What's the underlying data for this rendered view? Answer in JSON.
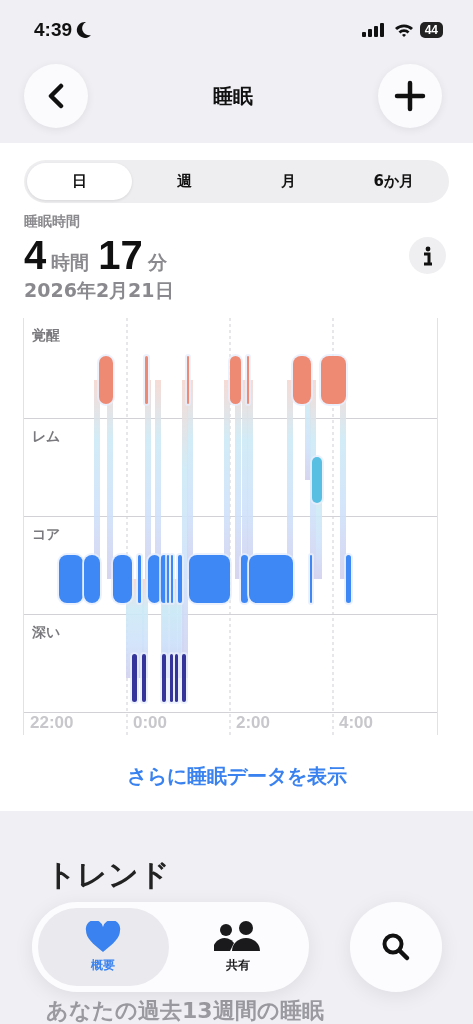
{
  "status_bar": {
    "time": "4:39",
    "battery": "44"
  },
  "nav": {
    "title": "睡眠"
  },
  "period_tabs": [
    {
      "label": "日",
      "selected": true
    },
    {
      "label": "週",
      "selected": false
    },
    {
      "label": "月",
      "selected": false
    },
    {
      "label": "6か月",
      "selected": false
    }
  ],
  "summary": {
    "label": "睡眠時間",
    "hours": "4",
    "hours_unit": "時間",
    "minutes": "17",
    "minutes_unit": "分",
    "date": "2026年2月21日"
  },
  "stages": [
    "覚醒",
    "レム",
    "コア",
    "深い"
  ],
  "time_labels": [
    "22:00",
    "0:00",
    "2:00",
    "4:00"
  ],
  "more_link": "さらに睡眠データを表示",
  "trends": {
    "title": "トレンド",
    "subtitle": "あなたの過去13週間の睡眠"
  },
  "tab_bar": [
    {
      "label": "概要",
      "selected": true
    },
    {
      "label": "共有",
      "selected": false
    }
  ]
}
